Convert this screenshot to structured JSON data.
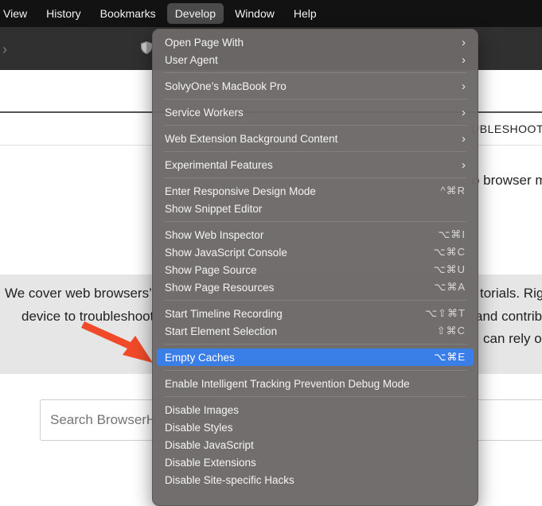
{
  "menubar": {
    "items": [
      "View",
      "History",
      "Bookmarks",
      "Develop",
      "Window",
      "Help"
    ],
    "active_index": 3
  },
  "page": {
    "nav_tail": "UBLESHOOT",
    "hero_tail": "o browser m",
    "band_lines_left": [
      "We cover web browsers’",
      "device to troubleshoot"
    ],
    "band_lines_right": [
      "torials. Righ",
      "and contribu",
      "can rely o"
    ],
    "search_placeholder": "Search BrowserH"
  },
  "develop_menu": {
    "groups": [
      [
        {
          "label": "Open Page With",
          "submenu": true
        },
        {
          "label": "User Agent",
          "submenu": true
        }
      ],
      [
        {
          "label": "SolvyOne’s MacBook Pro",
          "submenu": true
        }
      ],
      [
        {
          "label": "Service Workers",
          "submenu": true
        }
      ],
      [
        {
          "label": "Web Extension Background Content",
          "submenu": true
        }
      ],
      [
        {
          "label": "Experimental Features",
          "submenu": true
        }
      ],
      [
        {
          "label": "Enter Responsive Design Mode",
          "shortcut": "^⌘R"
        },
        {
          "label": "Show Snippet Editor"
        }
      ],
      [
        {
          "label": "Show Web Inspector",
          "shortcut": "⌥⌘I"
        },
        {
          "label": "Show JavaScript Console",
          "shortcut": "⌥⌘C"
        },
        {
          "label": "Show Page Source",
          "shortcut": "⌥⌘U"
        },
        {
          "label": "Show Page Resources",
          "shortcut": "⌥⌘A"
        }
      ],
      [
        {
          "label": "Start Timeline Recording",
          "shortcut": "⌥⇧⌘T"
        },
        {
          "label": "Start Element Selection",
          "shortcut": "⇧⌘C"
        }
      ],
      [
        {
          "label": "Empty Caches",
          "shortcut": "⌥⌘E",
          "highlighted": true
        }
      ],
      [
        {
          "label": "Enable Intelligent Tracking Prevention Debug Mode"
        }
      ],
      [
        {
          "label": "Disable Images"
        },
        {
          "label": "Disable Styles"
        },
        {
          "label": "Disable JavaScript"
        },
        {
          "label": "Disable Extensions"
        },
        {
          "label": "Disable Site-specific Hacks"
        }
      ]
    ]
  },
  "colors": {
    "highlight": "#3a7ee8",
    "arrow": "#f04a2a",
    "menubar": "#121212"
  }
}
